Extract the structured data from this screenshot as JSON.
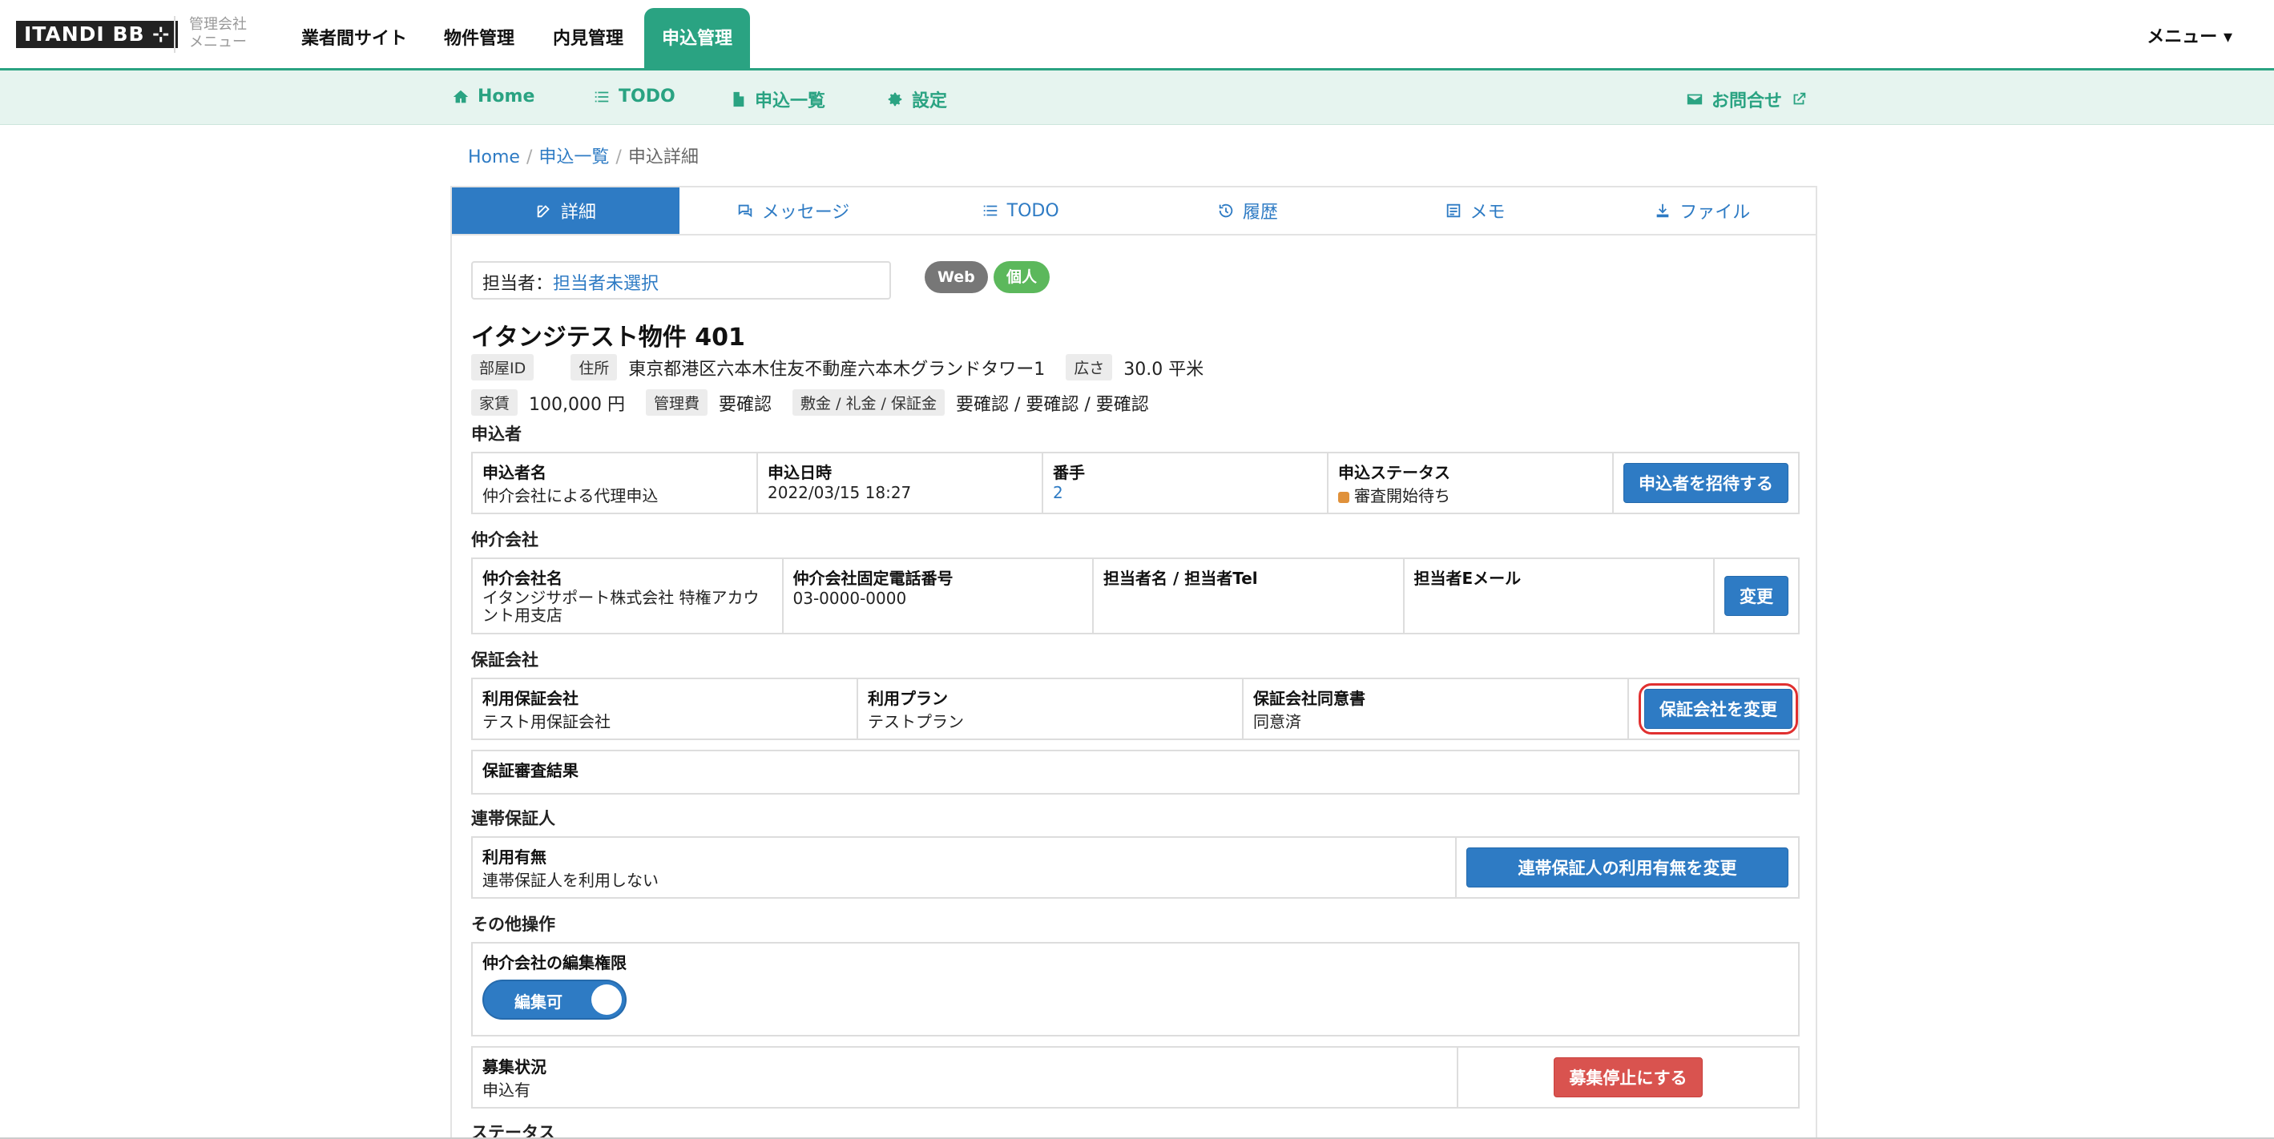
{
  "brand": {
    "logo": "ITANDI BB ⊹",
    "sub_line1": "管理会社",
    "sub_line2": "メニュー"
  },
  "topnav": {
    "items": [
      "業者間サイト",
      "物件管理",
      "内見管理",
      "申込管理"
    ],
    "menu": "メニュー ▾"
  },
  "subnav": {
    "home": "Home",
    "todo": "TODO",
    "list": "申込一覧",
    "settings": "設定",
    "contact": "お問合せ"
  },
  "breadcrumb": {
    "home": "Home",
    "list": "申込一覧",
    "current": "申込詳細"
  },
  "tabs": [
    "詳細",
    "メッセージ",
    "TODO",
    "履歴",
    "メモ",
    "ファイル"
  ],
  "assignee": {
    "label": "担当者：",
    "value": "担当者未選択"
  },
  "badges": {
    "web": "Web",
    "individual": "個人"
  },
  "property": {
    "title": "イタンジテスト物件 401",
    "room_id_label": "部屋ID",
    "address_label": "住所",
    "address": "東京都港区六本木住友不動産六本木グランドタワー1",
    "area_label": "広さ",
    "area": "30.0 平米",
    "rent_label": "家賃",
    "rent": "100,000 円",
    "mgmt_label": "管理費",
    "mgmt": "要確認",
    "deposit_label": "敷金 / 礼金 / 保証金",
    "deposit": "要確認 / 要確認 / 要確認"
  },
  "applicant": {
    "section": "申込者",
    "name_h": "申込者名",
    "name_v": "仲介会社による代理申込",
    "date_h": "申込日時",
    "date_v": "2022/03/15 18:27",
    "num_h": "番手",
    "num_v": "2",
    "status_h": "申込ステータス",
    "status_v": "審査開始待ち",
    "invite_btn": "申込者を招待する"
  },
  "broker": {
    "section": "仲介会社",
    "name_h": "仲介会社名",
    "name_v": "イタンジサポート株式会社 特権アカウント用支店",
    "tel_h": "仲介会社固定電話番号",
    "tel_v": "03-0000-0000",
    "staff_h": "担当者名 / 担当者Tel",
    "email_h": "担当者Eメール",
    "change_btn": "変更"
  },
  "guarantee": {
    "section": "保証会社",
    "company_h": "利用保証会社",
    "company_v": "テスト用保証会社",
    "plan_h": "利用プラン",
    "plan_v": "テストプラン",
    "consent_h": "保証会社同意書",
    "consent_v": "同意済",
    "change_btn": "保証会社を変更",
    "result_h": "保証審査結果"
  },
  "joint": {
    "section": "連帯保証人",
    "use_h": "利用有無",
    "use_v": "連帯保証人を利用しない",
    "change_btn": "連帯保証人の利用有無を変更"
  },
  "other": {
    "section": "その他操作",
    "edit_h": "仲介会社の編集権限",
    "toggle": "編集可",
    "recruit_h": "募集状況",
    "recruit_v": "申込有",
    "stop_btn": "募集停止にする"
  },
  "status_section": "ステータス"
}
